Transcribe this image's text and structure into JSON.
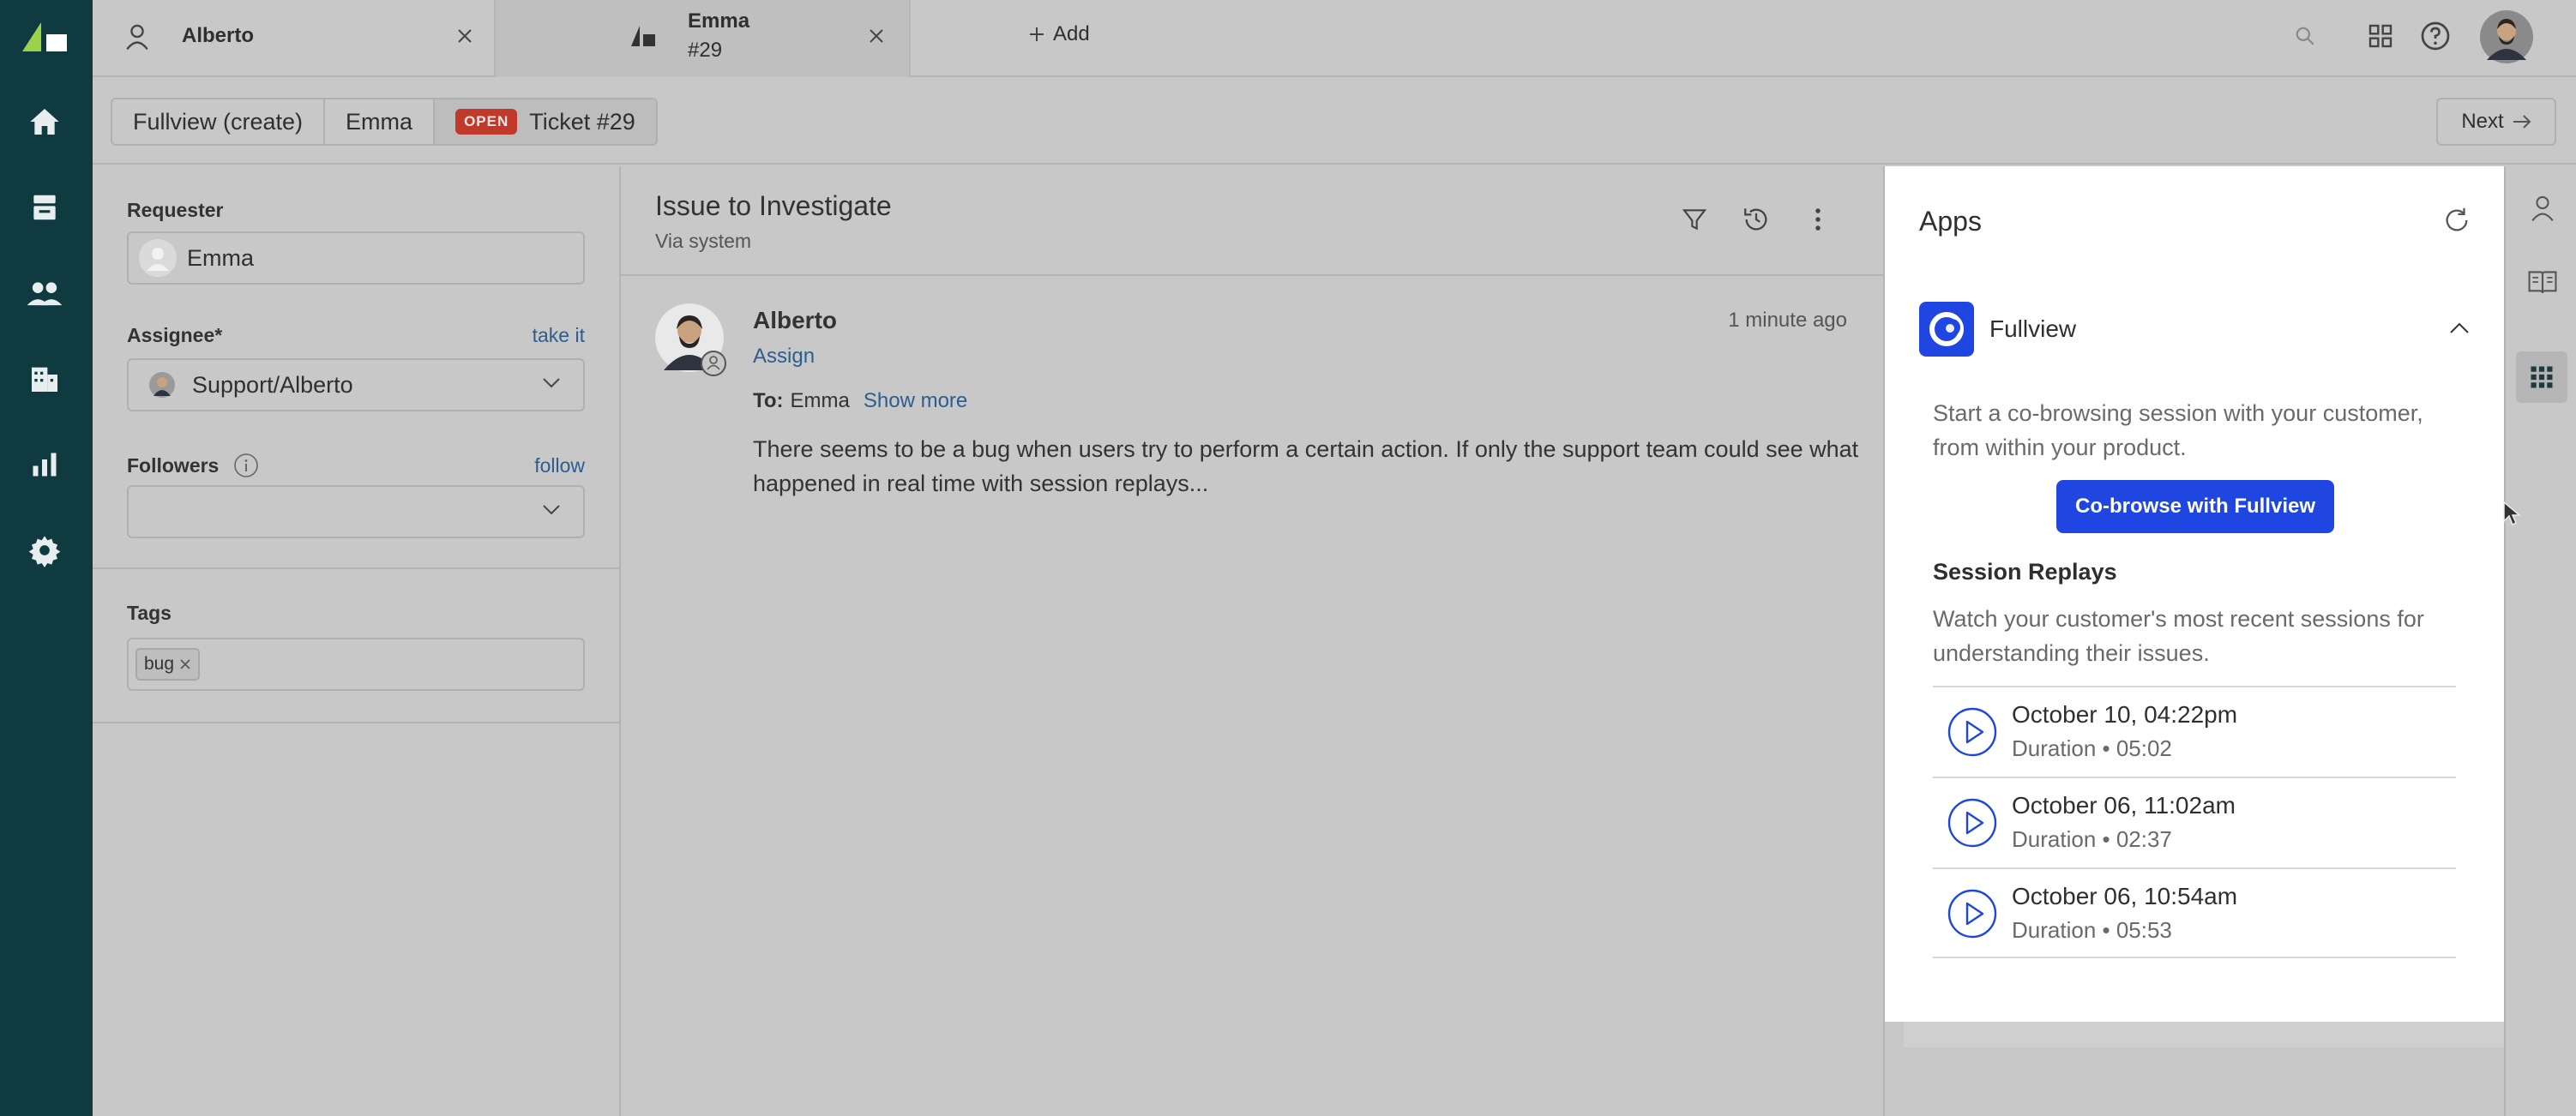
{
  "tabs": [
    {
      "title": "Alberto",
      "subtitle": ""
    },
    {
      "title": "Emma",
      "subtitle": "#29"
    }
  ],
  "tab_add_label": "Add",
  "breadcrumb": {
    "items": [
      "Fullview (create)",
      "Emma"
    ],
    "status_badge": "OPEN",
    "ticket": "Ticket #29"
  },
  "next_label": "Next",
  "properties": {
    "requester_label": "Requester",
    "requester_value": "Emma",
    "assignee_label": "Assignee*",
    "take_it": "take it",
    "assignee_value": "Support/Alberto",
    "followers_label": "Followers",
    "follow": "follow",
    "followers_value": "",
    "tags_label": "Tags",
    "tags": [
      "bug"
    ]
  },
  "conversation": {
    "subject": "Issue to Investigate",
    "via": "Via system",
    "message": {
      "author": "Alberto",
      "time": "1 minute ago",
      "assign": "Assign",
      "to_label": "To:",
      "to_value": "Emma",
      "show_more": "Show more",
      "body": "There seems to be a bug when users try to perform a certain action. If only the support team could see what happened in real time with session replays..."
    }
  },
  "apps": {
    "title": "Apps",
    "app_name": "Fullview",
    "intro": "Start a co-browsing session with your customer, from within your product.",
    "cobrowse_label": "Co-browse with Fullview",
    "replays_title": "Session Replays",
    "replays_desc": "Watch your customer's most recent sessions for understanding their issues.",
    "replays": [
      {
        "date": "October 10, 04:22pm",
        "duration": "Duration • 05:02"
      },
      {
        "date": "October 06, 11:02am",
        "duration": "Duration • 02:37"
      },
      {
        "date": "October 06, 10:54am",
        "duration": "Duration • 05:53"
      }
    ]
  },
  "colors": {
    "nav_bg": "#0f3a3f",
    "accent": "#1f46e0",
    "link": "#2d5d8f",
    "open_badge": "#c0392b"
  },
  "icons": {
    "nav": [
      "home-icon",
      "views-icon",
      "customers-icon",
      "organizations-icon",
      "reporting-icon",
      "admin-gear-icon"
    ],
    "top": [
      "search-icon",
      "products-grid-icon",
      "help-icon",
      "user-avatar"
    ],
    "rail": [
      "customer-context-icon",
      "knowledge-icon",
      "apps-icon"
    ]
  }
}
